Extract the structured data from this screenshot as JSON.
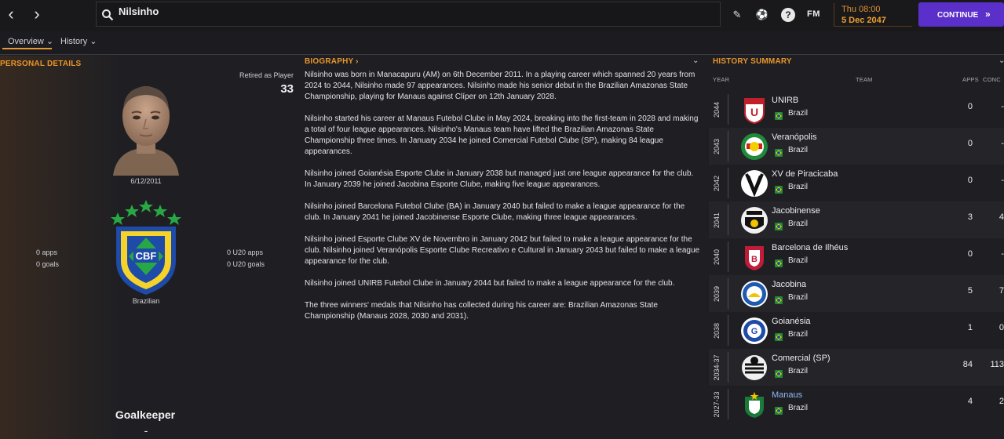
{
  "topbar": {
    "search_value": "Nilsinho",
    "fm_label": "FM",
    "day_time": "Thu 08:00",
    "date": "5 Dec 2047",
    "continue_label": "CONTINUE"
  },
  "tabs": [
    {
      "label": "Overview"
    },
    {
      "label": "History"
    }
  ],
  "personal": {
    "title": "PERSONAL DETAILS",
    "retired_label": "Retired as Player",
    "retired_age": "33",
    "dob": "6/12/2011",
    "nationality": "Brazilian",
    "apps": "0 apps",
    "goals": "0 goals",
    "u20_apps": "0 U20 apps",
    "u20_goals": "0 U20 goals",
    "position": "Goalkeeper",
    "position_sub": "-"
  },
  "biography": {
    "title": "BIOGRAPHY",
    "paragraphs": [
      "Nilsinho was born in Manacapuru (AM) on 6th December 2011. In a playing career which spanned 20 years from 2024 to 2044, Nilsinho made 97 appearances. Nilsinho made his senior debut in the Brazilian Amazonas State Championship, playing for Manaus against Clíper on 12th January 2028.",
      "Nilsinho started his career at Manaus Futebol Clube in May 2024, breaking into the first-team in 2028 and making a total of four league appearances. Nilsinho's Manaus team have lifted the Brazilian Amazonas State Championship three times. In January 2034 he joined Comercial Futebol Clube (SP), making 84 league appearances.",
      "Nilsinho joined Goianésia Esporte Clube in January 2038 but managed just one league appearance for the club. In January 2039 he joined Jacobina Esporte Clube, making five league appearances.",
      "Nilsinho joined Barcelona Futebol Clube (BA) in January 2040 but failed to make a league appearance for the club. In January 2041 he joined Jacobinense Esporte Clube, making three league appearances.",
      "Nilsinho joined Esporte Clube XV de Novembro in January 2042 but failed to make a league appearance for the club. Nilsinho joined Veranópolis Esporte Clube Recreativo e Cultural in January 2043 but failed to make a league appearance for the club.",
      "Nilsinho joined UNIRB Futebol Clube in January 2044 but failed to make a league appearance for the club.",
      "The three winners' medals that Nilsinho has collected during his career are: Brazilian Amazonas State Championship (Manaus 2028, 2030 and 2031)."
    ]
  },
  "history": {
    "title": "HISTORY SUMMARY",
    "col_year": "YEAR",
    "col_team": "TEAM",
    "col_apps": "APPS",
    "col_conc": "CONC",
    "rows": [
      {
        "year": "2044",
        "team": "UNIRB",
        "country": "Brazil",
        "apps": "0",
        "conc": "-"
      },
      {
        "year": "2043",
        "team": "Veranópolis",
        "country": "Brazil",
        "apps": "0",
        "conc": "-"
      },
      {
        "year": "2042",
        "team": "XV de Piracicaba",
        "country": "Brazil",
        "apps": "0",
        "conc": "-"
      },
      {
        "year": "2041",
        "team": "Jacobinense",
        "country": "Brazil",
        "apps": "3",
        "conc": "4"
      },
      {
        "year": "2040",
        "team": "Barcelona de Ilhéus",
        "country": "Brazil",
        "apps": "0",
        "conc": "-"
      },
      {
        "year": "2039",
        "team": "Jacobina",
        "country": "Brazil",
        "apps": "5",
        "conc": "7"
      },
      {
        "year": "2038",
        "team": "Goianésia",
        "country": "Brazil",
        "apps": "1",
        "conc": "0"
      },
      {
        "year": "2034-37",
        "team": "Comercial (SP)",
        "country": "Brazil",
        "apps": "84",
        "conc": "113"
      },
      {
        "year": "2027-33",
        "team": "Manaus",
        "country": "Brazil",
        "apps": "4",
        "conc": "2"
      }
    ]
  },
  "colors": {
    "accent": "#e8962a",
    "continue": "#5b2fc9",
    "link": "#8fb8f0"
  }
}
